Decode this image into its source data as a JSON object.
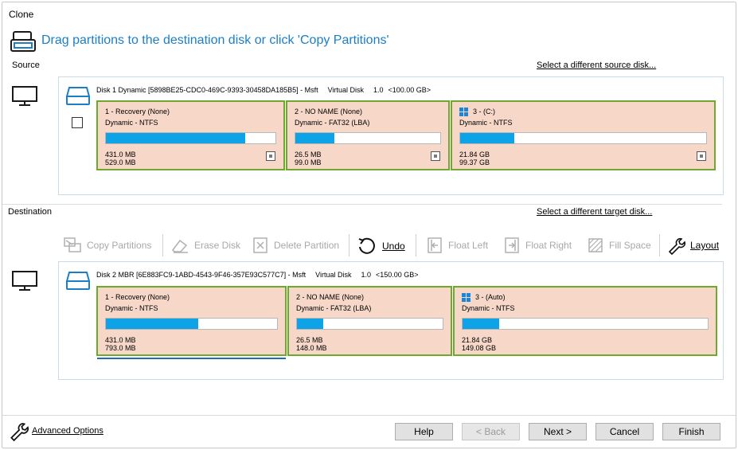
{
  "window": {
    "title": "Clone"
  },
  "header": {
    "text": "Drag partitions to the destination disk or click 'Copy Partitions'"
  },
  "source": {
    "label": "Source",
    "link": "Select a different source disk...",
    "disk": {
      "name": "Disk 1 Dynamic [5898BE25-CDC0-469C-9393-30458DA185B5] - Msft",
      "type": "Virtual Disk",
      "version": "1.0",
      "size": "<100.00 GB>"
    },
    "partitions": [
      {
        "title": "1 - Recovery (None)",
        "fs": "Dynamic - NTFS",
        "used": "431.0 MB",
        "total": "529.0 MB",
        "fill": 0.82,
        "windows": false
      },
      {
        "title": "2 - NO NAME (None)",
        "fs": "Dynamic - FAT32 (LBA)",
        "used": "26.5 MB",
        "total": "99.0 MB",
        "fill": 0.27,
        "windows": false
      },
      {
        "title": "3 -  (C:)",
        "fs": "Dynamic - NTFS",
        "used": "21.84 GB",
        "total": "99.37 GB",
        "fill": 0.22,
        "windows": true
      }
    ]
  },
  "destination": {
    "label": "Destination",
    "link": "Select a different target disk...",
    "toolbar": {
      "copy_partitions": "Copy Partitions",
      "erase_disk": "Erase Disk",
      "delete_partition": "Delete Partition",
      "undo": "Undo",
      "float_left": "Float Left",
      "float_right": "Float Right",
      "fill_space": "Fill Space",
      "layout": "Layout"
    },
    "disk": {
      "name": "Disk 2 MBR [6E883FC9-1ABD-4543-9F46-357E93C577C7] - Msft",
      "type": "Virtual Disk",
      "version": "1.0",
      "size": "<150.00 GB>"
    },
    "partitions": [
      {
        "title": "1 - Recovery (None)",
        "fs": "Dynamic - NTFS",
        "used": "431.0 MB",
        "total": "793.0 MB",
        "fill": 0.54,
        "windows": false
      },
      {
        "title": "2 - NO NAME (None)",
        "fs": "Dynamic - FAT32 (LBA)",
        "used": "26.5 MB",
        "total": "148.0 MB",
        "fill": 0.18,
        "windows": false
      },
      {
        "title": "3 -  (Auto)",
        "fs": "Dynamic - NTFS",
        "used": "21.84 GB",
        "total": "149.08 GB",
        "fill": 0.15,
        "windows": true
      }
    ]
  },
  "footer": {
    "advanced_options": "Advanced Options",
    "help": "Help",
    "back": "< Back",
    "next": "Next >",
    "cancel": "Cancel",
    "finish": "Finish"
  }
}
